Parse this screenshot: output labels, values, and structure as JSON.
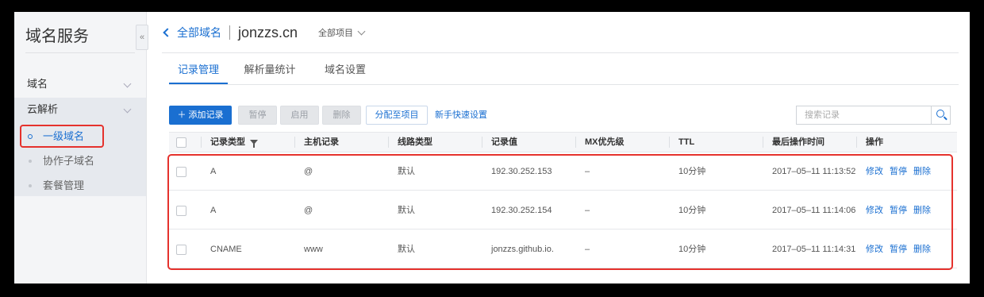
{
  "sidebar": {
    "title": "域名服务",
    "sections": [
      {
        "label": "域名"
      },
      {
        "label": "云解析"
      }
    ],
    "items": [
      {
        "label": "一级域名",
        "active": true
      },
      {
        "label": "协作子域名"
      },
      {
        "label": "套餐管理"
      }
    ],
    "collapse_icon": "«"
  },
  "header": {
    "back_label": "全部域名",
    "domain": "jonzzs.cn",
    "project_label": "全部项目"
  },
  "tabs": [
    {
      "label": "记录管理",
      "active": true
    },
    {
      "label": "解析量统计"
    },
    {
      "label": "域名设置"
    }
  ],
  "toolbar": {
    "add_label": "添加记录",
    "pause_label": "暂停",
    "enable_label": "启用",
    "delete_label": "删除",
    "assign_label": "分配至项目",
    "guide_label": "新手快速设置",
    "search_placeholder": "搜索记录"
  },
  "table": {
    "columns": [
      "记录类型",
      "主机记录",
      "线路类型",
      "记录值",
      "MX优先级",
      "TTL",
      "最后操作时间",
      "操作"
    ],
    "rows": [
      {
        "type": "A",
        "host": "@",
        "line": "默认",
        "value": "192.30.252.153",
        "mx": "–",
        "ttl": "10分钟",
        "time": "2017–05–11 11:13:52"
      },
      {
        "type": "A",
        "host": "@",
        "line": "默认",
        "value": "192.30.252.154",
        "mx": "–",
        "ttl": "10分钟",
        "time": "2017–05–11 11:14:06"
      },
      {
        "type": "CNAME",
        "host": "www",
        "line": "默认",
        "value": "jonzzs.github.io.",
        "mx": "–",
        "ttl": "10分钟",
        "time": "2017–05–11 11:14:31"
      }
    ],
    "actions": {
      "edit": "修改",
      "pause": "暂停",
      "delete": "删除"
    }
  },
  "colors": {
    "accent": "#1a6fd1",
    "highlight": "#e5322d"
  }
}
